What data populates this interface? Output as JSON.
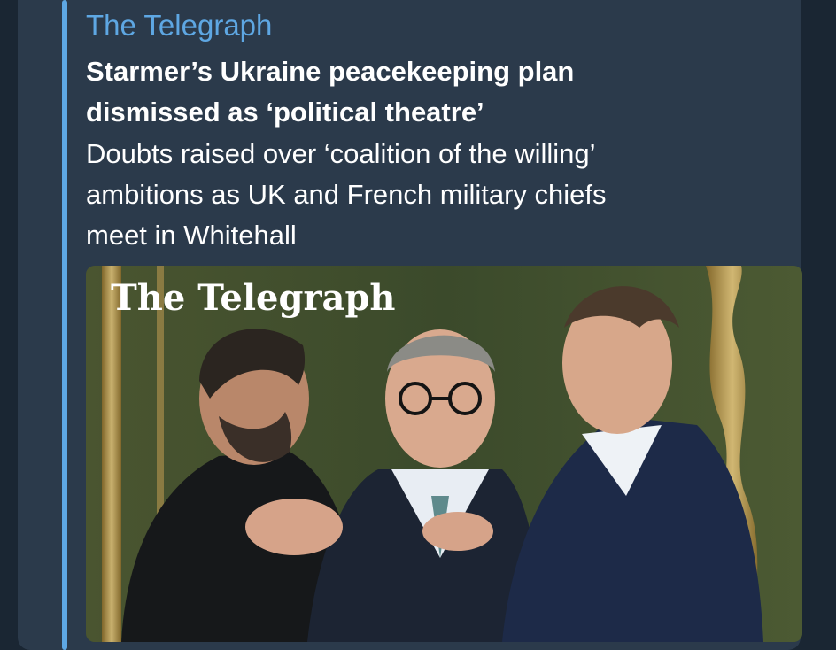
{
  "link_preview": {
    "site_name": "The Telegraph",
    "headline_line1": "Starmer’s Ukraine peacekeeping plan",
    "headline_line2": "dismissed as ‘political theatre’",
    "description_line1": "Doubts raised over ‘coalition of the willing’",
    "description_line2": "ambitions as UK and French military chiefs",
    "description_line3": "meet in Whitehall",
    "image_watermark": "The Telegraph",
    "image_description_icon": "news-photo"
  },
  "colors": {
    "accent": "#5ea7e3",
    "bubble": "#2b3a4b",
    "background": "#1a2633",
    "text": "#ffffff"
  }
}
